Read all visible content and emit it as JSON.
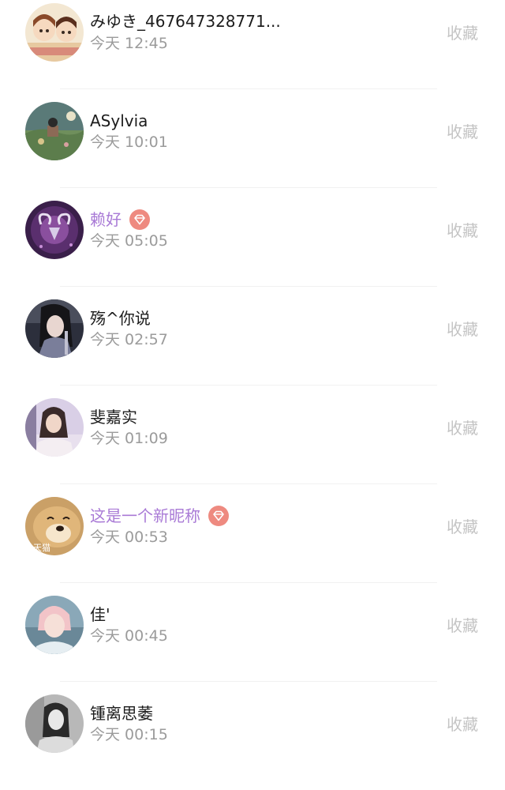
{
  "users": [
    {
      "name": "みゆき_467647328771...",
      "time": "今天 12:45",
      "action": "收藏",
      "vip": false
    },
    {
      "name": "ASylvia",
      "time": "今天 10:01",
      "action": "收藏",
      "vip": false
    },
    {
      "name": "赖好",
      "time": "今天 05:05",
      "action": "收藏",
      "vip": true
    },
    {
      "name": "殇^你说",
      "time": "今天 02:57",
      "action": "收藏",
      "vip": false
    },
    {
      "name": "斐嘉实",
      "time": "今天 01:09",
      "action": "收藏",
      "vip": false
    },
    {
      "name": "这是一个新昵称",
      "time": "今天 00:53",
      "action": "收藏",
      "vip": true
    },
    {
      "name": "佳'",
      "time": "今天 00:45",
      "action": "收藏",
      "vip": false
    },
    {
      "name": "锺离思萎",
      "time": "今天 00:15",
      "action": "收藏",
      "vip": false
    }
  ],
  "avatar_watermark": "天猫",
  "colors": {
    "vip_name": "#a97ad6",
    "vip_badge": "#ee8a80",
    "name": "#1c1c1c",
    "time": "#9b9b9b",
    "action": "#c4c4c4"
  }
}
